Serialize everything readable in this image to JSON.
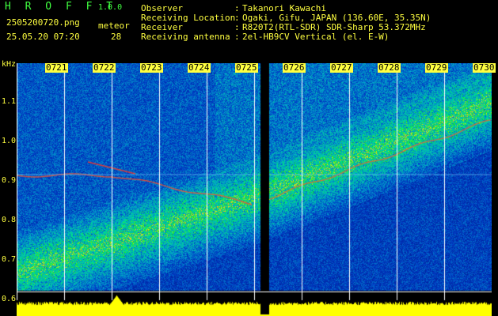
{
  "header": {
    "app_title": "H R O F F T",
    "app_version": "1.0.0",
    "file_name": "2505200720.png",
    "date_time": "25.05.20 07:20",
    "meteor_label": "meteor",
    "meteor_count": "28"
  },
  "info": [
    {
      "key": "Observer",
      "value": "Takanori Kawachi"
    },
    {
      "key": "Receiving Location",
      "value": "Ogaki, Gifu, JAPAN (136.60E, 35.35N)"
    },
    {
      "key": "Receiver",
      "value": "R820T2(RTL-SDR) SDR-Sharp 53.372MHz"
    },
    {
      "key": "Receiving antenna",
      "value": "2el-HB9CV Vertical (el. E-W)"
    }
  ],
  "axis": {
    "unit": "kHz",
    "freq_ticks": [
      "1.1",
      "1.0",
      "0.9",
      "0.8",
      "0.7",
      "0.6"
    ],
    "time_labels": [
      "0721",
      "0722",
      "0723",
      "0724",
      "0725",
      "0726",
      "0727",
      "0728",
      "0729",
      "0730"
    ]
  },
  "colors": {
    "background": "#000000",
    "text": "#ffff40",
    "title": "#40ff40",
    "noise_floor": "#0a1a8a",
    "level": "#ffff00"
  }
}
